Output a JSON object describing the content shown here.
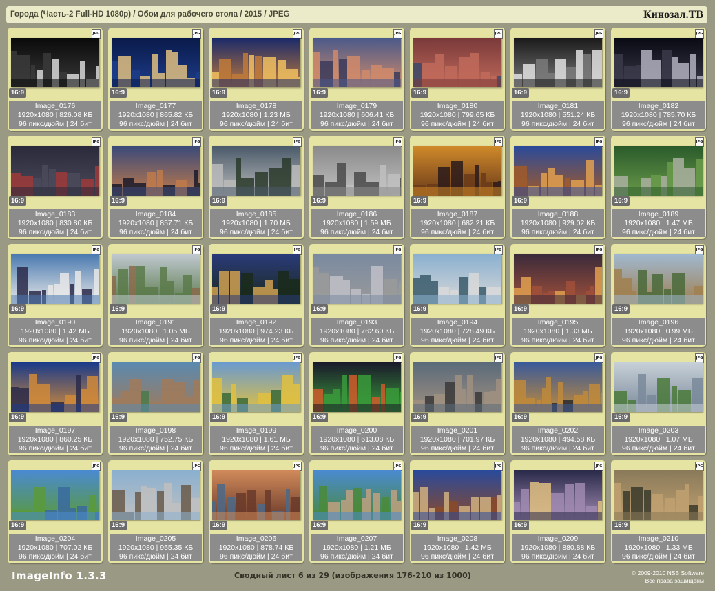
{
  "header": {
    "title": "Города (Часть-2 Full-HD 1080p) / Обои для рабочего стола / 2015 / JPEG",
    "brand": "Кинозал.ТВ"
  },
  "badge_text": "JPG",
  "images": [
    {
      "name": "Image_0176",
      "res": "1920x1080",
      "size": "826.08 КБ",
      "dpi": "96 пикс/дюйм",
      "bits": "24 бит",
      "ratio": "16:9",
      "palette": [
        "#0a0a0a",
        "#3a3a3a",
        "#d8d8d8"
      ]
    },
    {
      "name": "Image_0177",
      "res": "1920x1080",
      "size": "865.82 КБ",
      "dpi": "96 пикс/дюйм",
      "bits": "24 бит",
      "ratio": "16:9",
      "palette": [
        "#0a1a4a",
        "#1d3d8a",
        "#e0c080"
      ]
    },
    {
      "name": "Image_0178",
      "res": "1920x1080",
      "size": "1.23 МБ",
      "dpi": "96 пикс/дюйм",
      "bits": "24 бит",
      "ratio": "16:9",
      "palette": [
        "#1a2a6a",
        "#c07a3a",
        "#f0c060"
      ]
    },
    {
      "name": "Image_0179",
      "res": "1920x1080",
      "size": "606.41 КБ",
      "dpi": "96 пикс/дюйм",
      "bits": "24 бит",
      "ratio": "16:9",
      "palette": [
        "#4a5a8a",
        "#d08a6a",
        "#3a3a5a"
      ]
    },
    {
      "name": "Image_0180",
      "res": "1920x1080",
      "size": "799.65 КБ",
      "dpi": "96 пикс/дюйм",
      "bits": "24 бит",
      "ratio": "16:9",
      "palette": [
        "#7a3a3a",
        "#c06a5a",
        "#3a4a6a"
      ]
    },
    {
      "name": "Image_0181",
      "res": "1920x1080",
      "size": "551.24 КБ",
      "dpi": "96 пикс/дюйм",
      "bits": "24 бит",
      "ratio": "16:9",
      "palette": [
        "#1a1a1a",
        "#7a7a7a",
        "#e0e0e0"
      ]
    },
    {
      "name": "Image_0182",
      "res": "1920x1080",
      "size": "785.70 КБ",
      "dpi": "96 пикс/дюйм",
      "bits": "24 бит",
      "ratio": "16:9",
      "palette": [
        "#0a0a14",
        "#3a3a4a",
        "#b0b0c0"
      ]
    },
    {
      "name": "Image_0183",
      "res": "1920x1080",
      "size": "830.80 КБ",
      "dpi": "96 пикс/дюйм",
      "bits": "24 бит",
      "ratio": "16:9",
      "palette": [
        "#2a2a3a",
        "#4a4a5a",
        "#a03a3a"
      ]
    },
    {
      "name": "Image_0184",
      "res": "1920x1080",
      "size": "857.71 КБ",
      "dpi": "96 пикс/дюйм",
      "bits": "24 бит",
      "ratio": "16:9",
      "palette": [
        "#3a4a7a",
        "#c07a4a",
        "#1a1a2a"
      ]
    },
    {
      "name": "Image_0185",
      "res": "1920x1080",
      "size": "1.70 МБ",
      "dpi": "96 пикс/дюйм",
      "bits": "24 бит",
      "ratio": "16:9",
      "palette": [
        "#4a5a6a",
        "#bababa",
        "#2a3a2a"
      ]
    },
    {
      "name": "Image_0186",
      "res": "1920x1080",
      "size": "1.59 МБ",
      "dpi": "96 пикс/дюйм",
      "bits": "24 бит",
      "ratio": "16:9",
      "palette": [
        "#8a8a8a",
        "#c0c0c0",
        "#4a4a4a"
      ]
    },
    {
      "name": "Image_0187",
      "res": "1920x1080",
      "size": "682.21 КБ",
      "dpi": "96 пикс/дюйм",
      "bits": "24 бит",
      "ratio": "16:9",
      "palette": [
        "#d08a2a",
        "#6a3a1a",
        "#2a1a1a"
      ]
    },
    {
      "name": "Image_0188",
      "res": "1920x1080",
      "size": "929.02 КБ",
      "dpi": "96 пикс/дюйм",
      "bits": "24 бит",
      "ratio": "16:9",
      "palette": [
        "#2a4a9a",
        "#a05a2a",
        "#e0a050"
      ]
    },
    {
      "name": "Image_0189",
      "res": "1920x1080",
      "size": "1.47 МБ",
      "dpi": "96 пикс/дюйм",
      "bits": "24 бит",
      "ratio": "16:9",
      "palette": [
        "#2a5a2a",
        "#6a9a4a",
        "#aab0a0"
      ]
    },
    {
      "name": "Image_0190",
      "res": "1920x1080",
      "size": "1.42 МБ",
      "dpi": "96 пикс/дюйм",
      "bits": "24 бит",
      "ratio": "16:9",
      "palette": [
        "#4a7ab0",
        "#e8e8e8",
        "#2a2a4a"
      ]
    },
    {
      "name": "Image_0191",
      "res": "1920x1080",
      "size": "1.05 МБ",
      "dpi": "96 пикс/дюйм",
      "bits": "24 бит",
      "ratio": "16:9",
      "palette": [
        "#c0c8d0",
        "#5a7a4a",
        "#8a6a4a"
      ]
    },
    {
      "name": "Image_0192",
      "res": "1920x1080",
      "size": "974.23 КБ",
      "dpi": "96 пикс/дюйм",
      "bits": "24 бит",
      "ratio": "16:9",
      "palette": [
        "#2a3a7a",
        "#1a2a1a",
        "#d0a050"
      ]
    },
    {
      "name": "Image_0193",
      "res": "1920x1080",
      "size": "762.60 КБ",
      "dpi": "96 пикс/дюйм",
      "bits": "24 бит",
      "ratio": "16:9",
      "palette": [
        "#7a8aa0",
        "#9a9a9a",
        "#c0c0c8"
      ]
    },
    {
      "name": "Image_0194",
      "res": "1920x1080",
      "size": "728.49 КБ",
      "dpi": "96 пикс/дюйм",
      "bits": "24 бит",
      "ratio": "16:9",
      "palette": [
        "#8ab0d0",
        "#d8d8d8",
        "#3a5a6a"
      ]
    },
    {
      "name": "Image_0195",
      "res": "1920x1080",
      "size": "1.33 МБ",
      "dpi": "96 пикс/дюйм",
      "bits": "24 бит",
      "ratio": "16:9",
      "palette": [
        "#3a2a3a",
        "#a0503a",
        "#e0a050"
      ]
    },
    {
      "name": "Image_0196",
      "res": "1920x1080",
      "size": "0.99 МБ",
      "dpi": "96 пикс/дюйм",
      "bits": "24 бит",
      "ratio": "16:9",
      "palette": [
        "#a0b8d0",
        "#a08050",
        "#4a6a3a"
      ]
    },
    {
      "name": "Image_0197",
      "res": "1920x1080",
      "size": "860.25 КБ",
      "dpi": "96 пикс/дюйм",
      "bits": "24 бит",
      "ratio": "16:9",
      "palette": [
        "#1a3a8a",
        "#d08a3a",
        "#2a2a4a"
      ]
    },
    {
      "name": "Image_0198",
      "res": "1920x1080",
      "size": "752.75 КБ",
      "dpi": "96 пикс/дюйм",
      "bits": "24 бит",
      "ratio": "16:9",
      "palette": [
        "#5a8ab0",
        "#a07a5a",
        "#4a7a4a"
      ]
    },
    {
      "name": "Image_0199",
      "res": "1920x1080",
      "size": "1.61 МБ",
      "dpi": "96 пикс/дюйм",
      "bits": "24 бит",
      "ratio": "16:9",
      "palette": [
        "#6a9ad0",
        "#e0c040",
        "#3a6a3a"
      ]
    },
    {
      "name": "Image_0200",
      "res": "1920x1080",
      "size": "613.08 КБ",
      "dpi": "96 пикс/дюйм",
      "bits": "24 бит",
      "ratio": "16:9",
      "palette": [
        "#1a1a2a",
        "#3a9a3a",
        "#d05a2a"
      ]
    },
    {
      "name": "Image_0201",
      "res": "1920x1080",
      "size": "701.97 КБ",
      "dpi": "96 пикс/дюйм",
      "bits": "24 бит",
      "ratio": "16:9",
      "palette": [
        "#5a6a7a",
        "#a09080",
        "#3a3a3a"
      ]
    },
    {
      "name": "Image_0202",
      "res": "1920x1080",
      "size": "494.58 КБ",
      "dpi": "96 пикс/дюйм",
      "bits": "24 бит",
      "ratio": "16:9",
      "palette": [
        "#3a5a9a",
        "#c08a3a",
        "#2a2a2a"
      ]
    },
    {
      "name": "Image_0203",
      "res": "1920x1080",
      "size": "1.07 МБ",
      "dpi": "96 пикс/дюйм",
      "bits": "24 бит",
      "ratio": "16:9",
      "palette": [
        "#c8d0d8",
        "#7a8a9a",
        "#4a7a3a"
      ]
    },
    {
      "name": "Image_0204",
      "res": "1920x1080",
      "size": "707.02 КБ",
      "dpi": "96 пикс/дюйм",
      "bits": "24 бит",
      "ratio": "16:9",
      "palette": [
        "#4a8ad0",
        "#5a9a3a",
        "#3a6aa0"
      ]
    },
    {
      "name": "Image_0205",
      "res": "1920x1080",
      "size": "955.35 КБ",
      "dpi": "96 пикс/дюйм",
      "bits": "24 бит",
      "ratio": "16:9",
      "palette": [
        "#8ab0d0",
        "#c0c0c0",
        "#6a5a4a"
      ]
    },
    {
      "name": "Image_0206",
      "res": "1920x1080",
      "size": "878.74 КБ",
      "dpi": "96 пикс/дюйм",
      "bits": "24 бит",
      "ratio": "16:9",
      "palette": [
        "#d08a5a",
        "#6a3a2a",
        "#4a6a8a"
      ]
    },
    {
      "name": "Image_0207",
      "res": "1920x1080",
      "size": "1.21 МБ",
      "dpi": "96 пикс/дюйм",
      "bits": "24 бит",
      "ratio": "16:9",
      "palette": [
        "#4a8ad0",
        "#4a8a3a",
        "#c0a080"
      ]
    },
    {
      "name": "Image_0208",
      "res": "1920x1080",
      "size": "1.42 МБ",
      "dpi": "96 пикс/дюйм",
      "bits": "24 бит",
      "ratio": "16:9",
      "palette": [
        "#2a4a9a",
        "#8a4a2a",
        "#d0b080"
      ]
    },
    {
      "name": "Image_0209",
      "res": "1920x1080",
      "size": "880.88 КБ",
      "dpi": "96 пикс/дюйм",
      "bits": "24 бит",
      "ratio": "16:9",
      "palette": [
        "#2a2a4a",
        "#a08ab0",
        "#e0c080"
      ]
    },
    {
      "name": "Image_0210",
      "res": "1920x1080",
      "size": "1.33 МБ",
      "dpi": "96 пикс/дюйм",
      "bits": "24 бит",
      "ratio": "16:9",
      "palette": [
        "#8a7a5a",
        "#c0a070",
        "#3a3a2a"
      ]
    }
  ],
  "footer": {
    "app_name": "ImageInfo 1.3.3",
    "sheet_info": "Сводный лист 6 из 29 (изображения 176-210 из 1000)",
    "copyright": "© 2009-2010 NSB Software",
    "rights": "Все права защищены"
  }
}
